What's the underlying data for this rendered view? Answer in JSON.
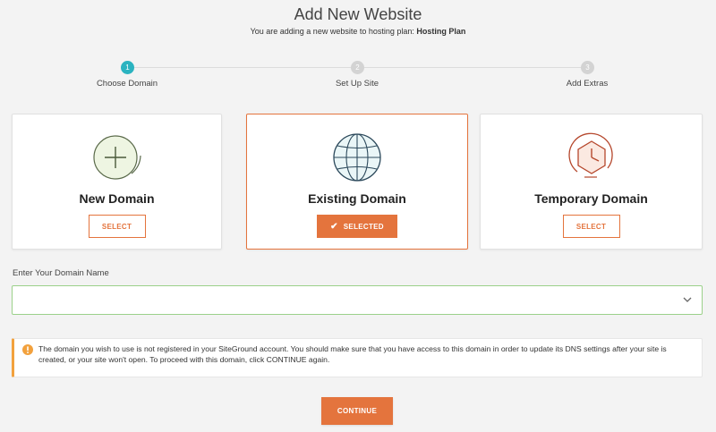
{
  "header": {
    "title": "Add New Website",
    "subtitle_prefix": "You are adding a new website to hosting plan: ",
    "plan_name": "Hosting Plan"
  },
  "steps": [
    {
      "number": "1",
      "label": "Choose Domain",
      "active": true
    },
    {
      "number": "2",
      "label": "Set Up Site",
      "active": false
    },
    {
      "number": "3",
      "label": "Add Extras",
      "active": false
    }
  ],
  "cards": [
    {
      "title": "New Domain",
      "button": "SELECT",
      "selected": false,
      "icon": "plus-circle-icon"
    },
    {
      "title": "Existing Domain",
      "button": "SELECTED",
      "selected": true,
      "icon": "globe-icon"
    },
    {
      "title": "Temporary Domain",
      "button": "SELECT",
      "selected": false,
      "icon": "clock-icon"
    }
  ],
  "domain_field": {
    "label": "Enter Your Domain Name",
    "value": ""
  },
  "warning": {
    "text": "The domain you wish to use is not registered in your SiteGround account. You should make sure that you have access to this domain in order to update its DNS settings after your site is created, or your site won't open. To proceed with this domain, click CONTINUE again."
  },
  "continue_button": "CONTINUE",
  "colors": {
    "accent": "#e4743d",
    "step_active": "#2bb3c0",
    "step_inactive": "#d3d3d3",
    "input_border": "#9bd18a",
    "warning": "#f2a13d"
  }
}
